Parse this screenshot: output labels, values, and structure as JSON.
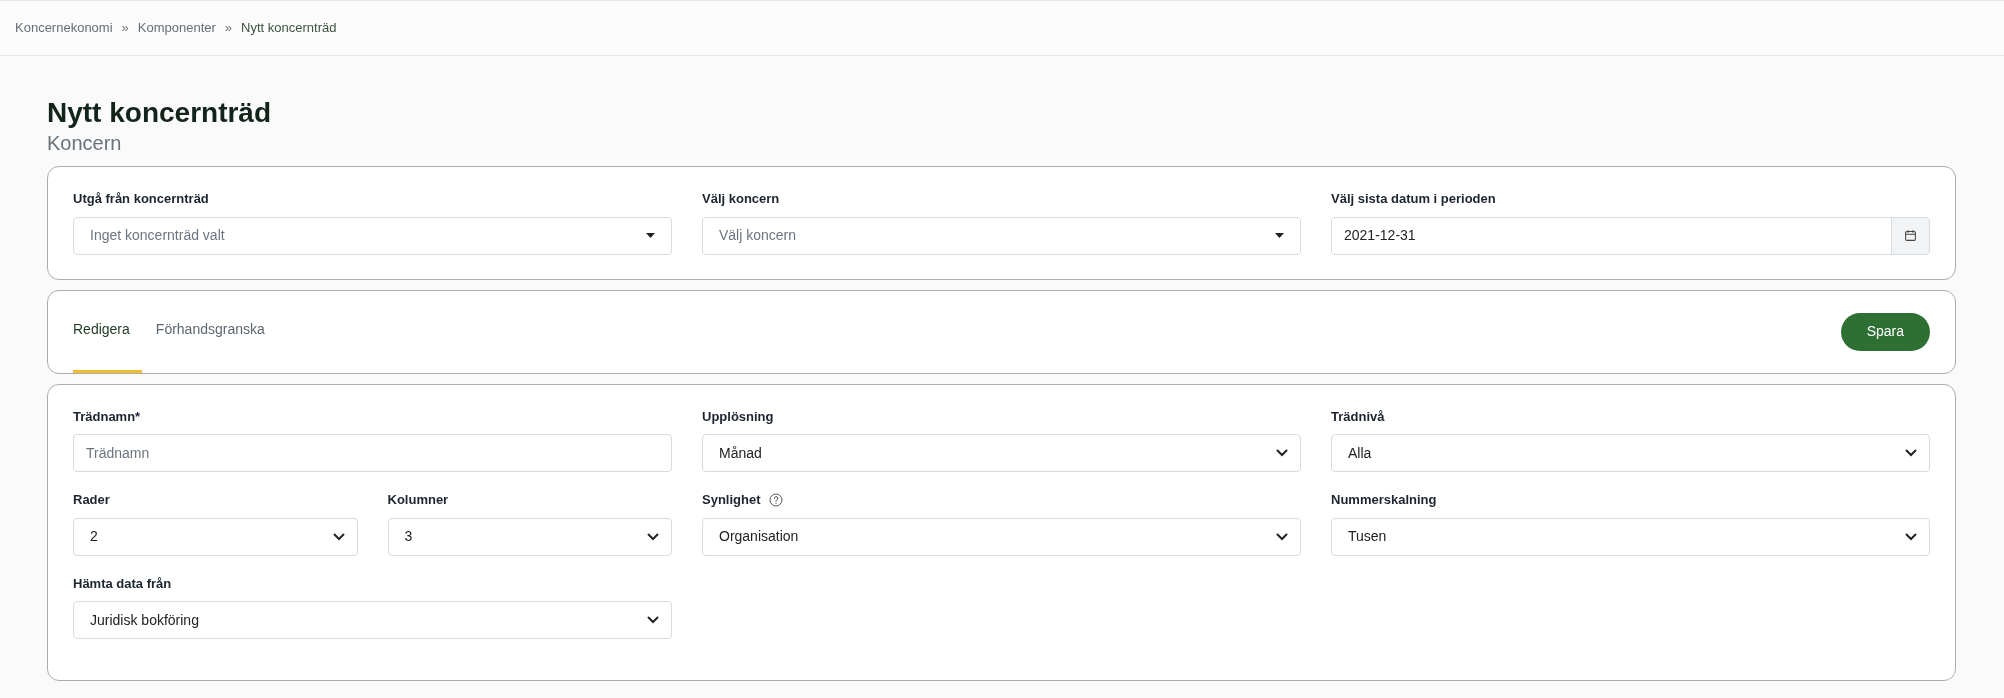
{
  "breadcrumb": [
    {
      "label": "Koncernekonomi",
      "current": false
    },
    {
      "label": "Komponenter",
      "current": false
    },
    {
      "label": "Nytt koncernträd",
      "current": true
    }
  ],
  "breadcrumb_separator": "»",
  "page": {
    "title": "Nytt koncernträd",
    "subtitle": "Koncern"
  },
  "selection_card": {
    "fields": [
      {
        "label": "Utgå från koncernträd",
        "kind": "dropdown",
        "placeholder": "Inget koncernträd valt"
      },
      {
        "label": "Välj koncern",
        "kind": "dropdown",
        "placeholder": "Välj koncern"
      },
      {
        "label": "Välj sista datum i perioden",
        "kind": "date",
        "value": "2021-12-31"
      }
    ]
  },
  "tabs": [
    {
      "label": "Redigera",
      "selected": true
    },
    {
      "label": "Förhandsgranska",
      "selected": false
    }
  ],
  "save_button": "Spara",
  "form": {
    "fields": [
      {
        "label": "Trädnamn*",
        "kind": "text",
        "placeholder": "Trädnamn",
        "help": false
      },
      {
        "label": "Upplösning",
        "kind": "select",
        "value": "Månad",
        "help": false
      },
      {
        "label": "Trädnivå",
        "kind": "select",
        "value": "Alla",
        "help": false
      },
      {
        "kind": "pair",
        "fields": [
          {
            "label": "Rader",
            "kind": "select",
            "value": "2",
            "help": false
          },
          {
            "label": "Kolumner",
            "kind": "select",
            "value": "3",
            "help": false
          }
        ]
      },
      {
        "label": "Synlighet",
        "kind": "select",
        "value": "Organisation",
        "help": true
      },
      {
        "label": "Nummerskalning",
        "kind": "select",
        "value": "Tusen",
        "help": false
      },
      {
        "label": "Hämta data från",
        "kind": "select",
        "value": "Juridisk bokföring",
        "help": false
      }
    ]
  }
}
